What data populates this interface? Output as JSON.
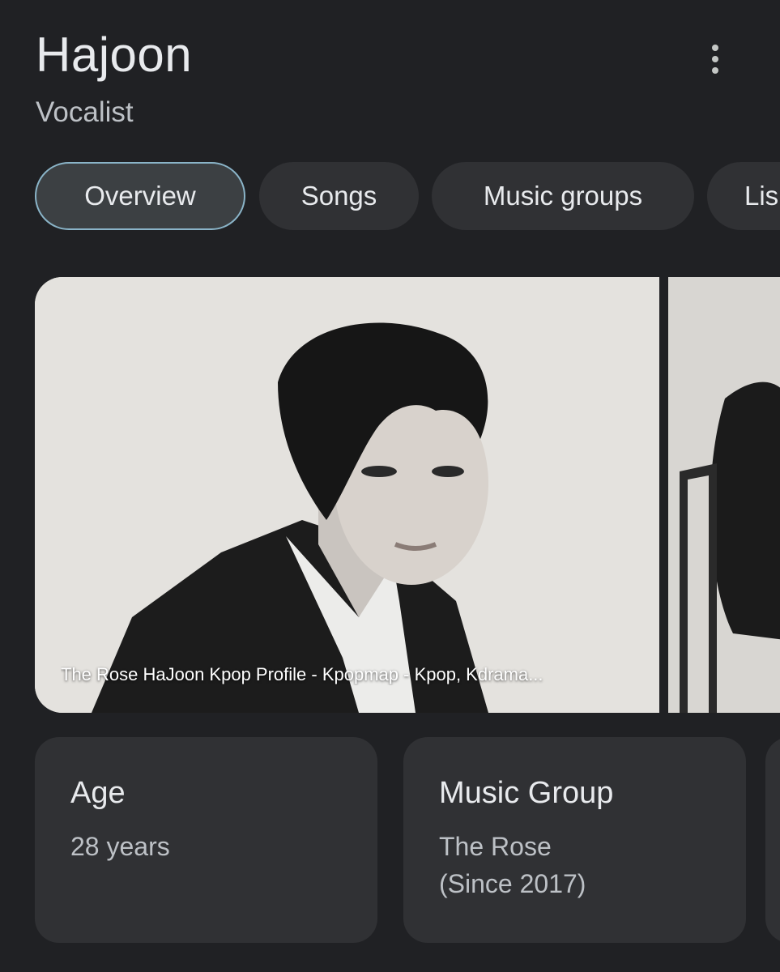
{
  "header": {
    "title": "Hajoon",
    "subtitle": "Vocalist"
  },
  "tabs": [
    {
      "label": "Overview",
      "selected": true
    },
    {
      "label": "Songs",
      "selected": false
    },
    {
      "label": "Music groups",
      "selected": false
    },
    {
      "label": "Lis",
      "selected": false
    }
  ],
  "images": [
    {
      "caption": "The Rose HaJoon Kpop Profile - Kpopmap - Kpop, Kdrama..."
    }
  ],
  "facts": [
    {
      "label": "Age",
      "value": "28 years"
    },
    {
      "label": "Music Group",
      "value_line1": "The Rose",
      "value_line2": "(Since 2017)"
    }
  ],
  "icons": {
    "more": "more-vert-icon"
  },
  "colors": {
    "background": "#202124",
    "chip": "#303134",
    "chip_selected_border": "#8ab4c8",
    "card": "#303134"
  }
}
